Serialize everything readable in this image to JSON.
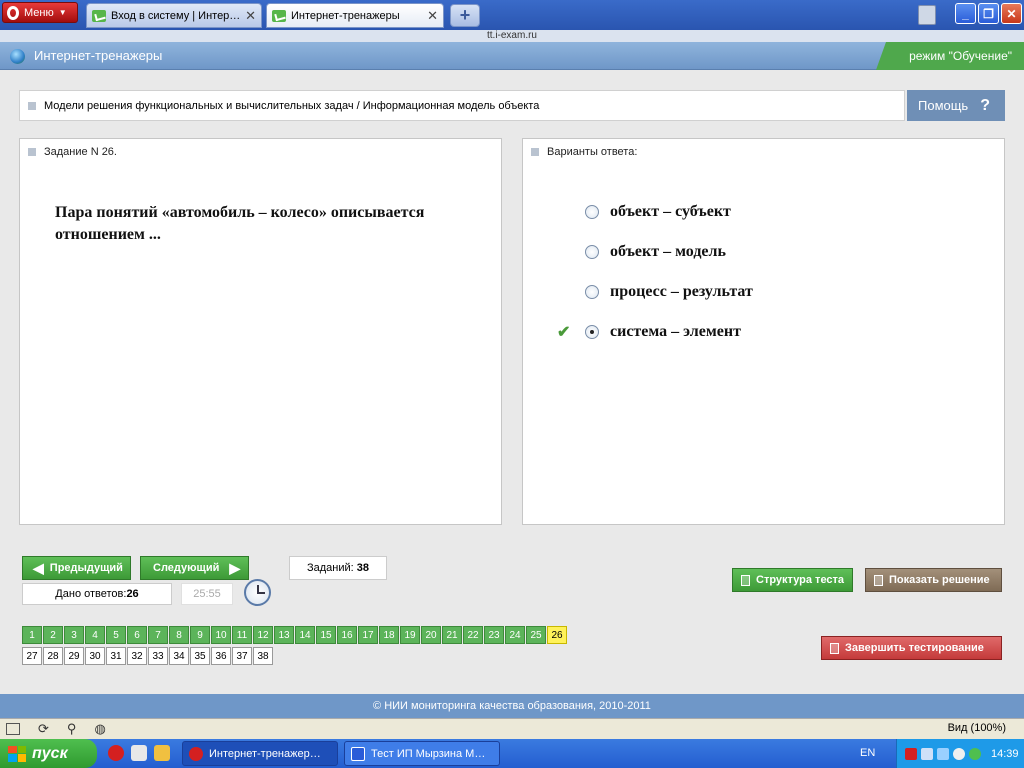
{
  "browser": {
    "menu_label": "Меню",
    "tabs": [
      {
        "title": "Вход в систему | Интер…",
        "close": "✕"
      },
      {
        "title": "Интернет-тренажеры",
        "close": "✕"
      }
    ],
    "new_tab": "+",
    "url": "tt.i-exam.ru",
    "zoom": "Вид (100%)"
  },
  "header": {
    "app_title": "Интернет-тренажеры",
    "mode": "режим \"Обучение\""
  },
  "breadcrumb": "Модели решения функциональных и вычислительных задач / Информационная модель объекта",
  "help": {
    "label": "Помощь",
    "icon": "?"
  },
  "task_panel": {
    "title": "Задание N 26.",
    "question": "Пара понятий «автомобиль – колесо» описывается отношением ..."
  },
  "answers_panel": {
    "title": "Варианты ответа:",
    "options": [
      {
        "text": "объект – субъект",
        "selected": false
      },
      {
        "text": "объект – модель",
        "selected": false
      },
      {
        "text": "процесс – результат",
        "selected": false
      },
      {
        "text": "система – элемент",
        "selected": true
      }
    ]
  },
  "nav": {
    "prev": "Предыдущий",
    "next": "Следующий",
    "tasks_label": "Заданий:",
    "tasks_count": "38",
    "answered_label": "Дано ответов:",
    "answered_count": "26",
    "timer": "25:55"
  },
  "actions": {
    "structure": "Структура теста",
    "show_solution": "Показать решение",
    "finish": "Завершить тестирование"
  },
  "question_grid": {
    "row1": [
      "1",
      "2",
      "3",
      "4",
      "5",
      "6",
      "7",
      "8",
      "9",
      "10",
      "11",
      "12",
      "13",
      "14",
      "15",
      "16",
      "17",
      "18",
      "19",
      "20",
      "21",
      "22",
      "23",
      "24",
      "25",
      "26"
    ],
    "row2": [
      "27",
      "28",
      "29",
      "30",
      "31",
      "32",
      "33",
      "34",
      "35",
      "36",
      "37",
      "38"
    ],
    "current": "26"
  },
  "footer": "© НИИ мониторинга качества образования, 2010-2011",
  "taskbar": {
    "start": "пуск",
    "items": [
      "Интернет-тренажер…",
      "Тест ИП Мырзина М…"
    ],
    "lang": "EN",
    "time": "14:39"
  },
  "colors": {
    "header_blue": "#6f97c8",
    "done_green": "#5cb45a",
    "current_yellow": "#fff25a",
    "finish_red": "#c43a3a",
    "mode_green": "#4fa84c"
  }
}
